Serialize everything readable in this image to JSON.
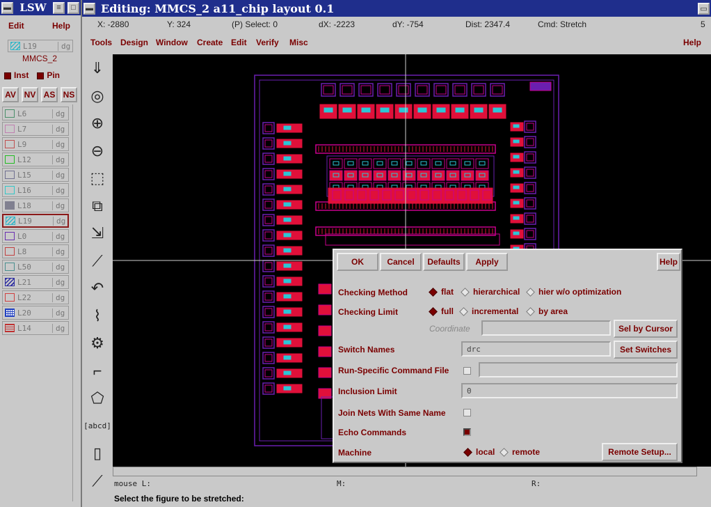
{
  "lsw": {
    "title": "LSW",
    "menu": {
      "edit": "Edit",
      "help": "Help"
    },
    "current_layer": {
      "name": "L19",
      "purpose": "dg"
    },
    "cell": "MMCS_2",
    "inst": "Inst",
    "pin": "Pin",
    "visibility_buttons": [
      "AV",
      "NV",
      "AS",
      "NS"
    ],
    "layers": [
      {
        "name": "L6",
        "purpose": "dg",
        "color": "#4a8f6a",
        "pattern": "outline",
        "selected": false
      },
      {
        "name": "L7",
        "purpose": "dg",
        "color": "#c07fb0",
        "pattern": "outline",
        "selected": false
      },
      {
        "name": "L9",
        "purpose": "dg",
        "color": "#c05050",
        "pattern": "outline",
        "selected": false
      },
      {
        "name": "L12",
        "purpose": "dg",
        "color": "#22bb22",
        "pattern": "outline",
        "selected": false
      },
      {
        "name": "L15",
        "purpose": "dg",
        "color": "#707090",
        "pattern": "outline",
        "selected": false
      },
      {
        "name": "L16",
        "purpose": "dg",
        "color": "#33c7c7",
        "pattern": "outline",
        "selected": false
      },
      {
        "name": "L18",
        "purpose": "dg",
        "color": "#808090",
        "pattern": "solid",
        "selected": false
      },
      {
        "name": "L19",
        "purpose": "dg",
        "color": "#36b6c6",
        "pattern": "hatch",
        "selected": true
      },
      {
        "name": "L0",
        "purpose": "dg",
        "color": "#6a2fb0",
        "pattern": "outline",
        "selected": false
      },
      {
        "name": "L8",
        "purpose": "dg",
        "color": "#c04040",
        "pattern": "outline",
        "selected": false
      },
      {
        "name": "L50",
        "purpose": "dg",
        "color": "#4a8f8f",
        "pattern": "outline",
        "selected": false
      },
      {
        "name": "L21",
        "purpose": "dg",
        "color": "#2a2aa0",
        "pattern": "hatch",
        "selected": false
      },
      {
        "name": "L22",
        "purpose": "dg",
        "color": "#d04040",
        "pattern": "outline",
        "selected": false
      },
      {
        "name": "L20",
        "purpose": "dg",
        "color": "#2040c0",
        "pattern": "grid",
        "selected": false
      },
      {
        "name": "L14",
        "purpose": "dg",
        "color": "#c03030",
        "pattern": "lines",
        "selected": false
      }
    ]
  },
  "editor": {
    "title": "Editing: MMCS_2 a11_chip layout 0.1",
    "window_number": "5",
    "status": {
      "x": "X: -2880",
      "y": "Y:  324",
      "select": "(P) Select: 0",
      "dx": "dX: -2223",
      "dy": "dY: -754",
      "dist": "Dist: 2347.4",
      "cmd": "Cmd: Stretch"
    },
    "menu": [
      "Tools",
      "Design",
      "Window",
      "Create",
      "Edit",
      "Verify",
      "Misc"
    ],
    "help": "Help",
    "tools": [
      "save-icon",
      "fit-view-icon",
      "zoom-in-icon",
      "zoom-out-icon",
      "area-select-icon",
      "copy-icon",
      "stretch-icon",
      "ruler-icon",
      "undo-icon",
      "wire-icon",
      "property-icon",
      "path-icon",
      "polygon-icon",
      "label-icon",
      "instance-icon",
      "move-icon"
    ],
    "label_tool_text": "[abcd]",
    "mouse": {
      "left": "mouse L:",
      "middle": "M:",
      "right": "R:"
    },
    "prompt": "Select the figure to be stretched:"
  },
  "dialog": {
    "buttons": {
      "ok": "OK",
      "cancel": "Cancel",
      "defaults": "Defaults",
      "apply": "Apply",
      "help": "Help"
    },
    "checking_method": {
      "label": "Checking Method",
      "options": [
        "flat",
        "hierarchical",
        "hier w/o optimization"
      ],
      "selected": "flat"
    },
    "checking_limit": {
      "label": "Checking Limit",
      "options": [
        "full",
        "incremental",
        "by area"
      ],
      "selected": "full"
    },
    "coordinate": {
      "label": "Coordinate",
      "value": "",
      "button": "Sel by Cursor"
    },
    "switch_names": {
      "label": "Switch Names",
      "value": "drc",
      "button": "Set Switches"
    },
    "run_specific": {
      "label": "Run-Specific Command File",
      "checked": false,
      "value": ""
    },
    "inclusion_limit": {
      "label": "Inclusion Limit",
      "value": "0"
    },
    "join_nets": {
      "label": "Join Nets With Same Name",
      "checked": false
    },
    "echo_commands": {
      "label": "Echo Commands",
      "checked": true
    },
    "machine": {
      "label": "Machine",
      "options": [
        "local",
        "remote"
      ],
      "selected": "local",
      "button": "Remote Setup..."
    }
  },
  "colors": {
    "title_bar": "#1f2e8c",
    "menu_text": "#7a0000",
    "panel": "#c9c9c9",
    "canvas": "#000000",
    "layout_magenta": "#c8008c",
    "layout_red": "#e0103a",
    "layout_cyan": "#2cc6d6",
    "layout_purple": "#6a1fb0"
  }
}
